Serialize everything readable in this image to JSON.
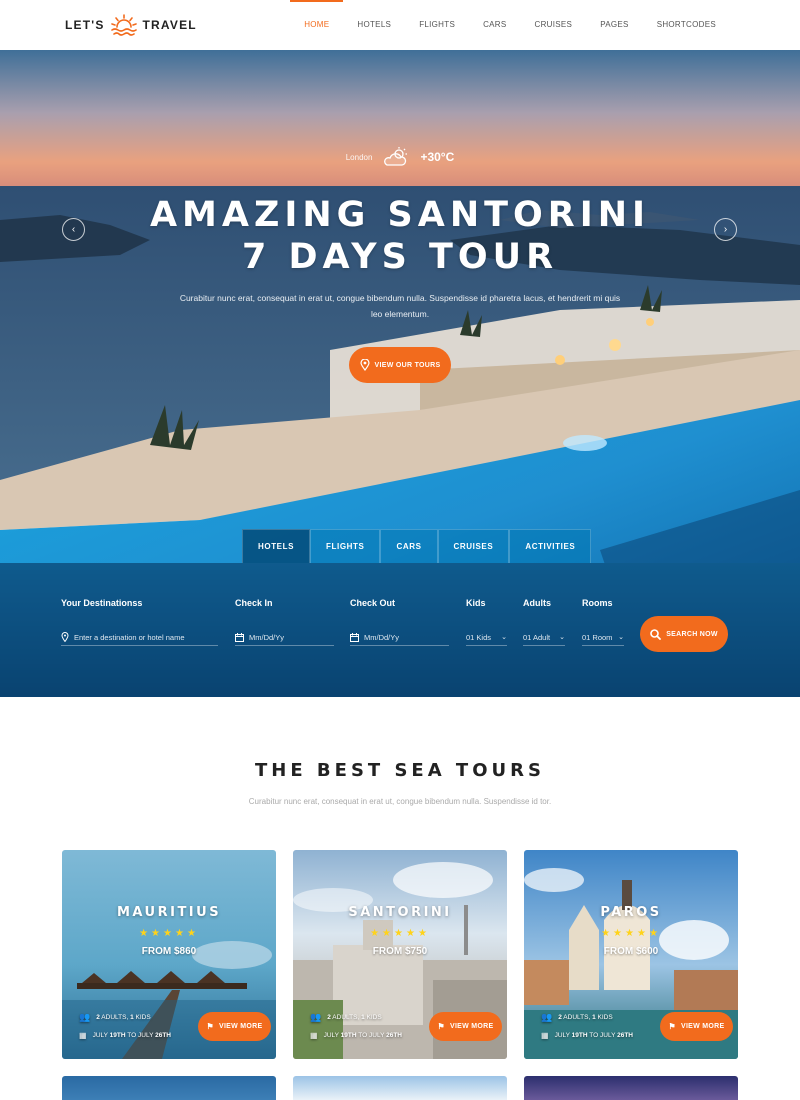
{
  "header": {
    "logo_left": "LET'S",
    "logo_right": "TRAVEL",
    "nav": [
      "HOME",
      "HOTELS",
      "FLIGHTS",
      "CARS",
      "CRUISES",
      "PAGES",
      "SHORTCODES"
    ],
    "active_nav": "HOME"
  },
  "hero": {
    "weather": {
      "city": "London",
      "temp": "+30°C",
      "icon": "partly-cloudy-icon"
    },
    "title_line1": "AMAZING SANTORINI",
    "title_line2": "7 DAYS TOUR",
    "description": "Curabitur nunc erat, consequat in erat ut, congue bibendum nulla. Suspendisse id pharetra lacus, et hendrerit mi quis leo elementum.",
    "cta_label": "VIEW OUR TOURS"
  },
  "search": {
    "tabs": [
      "HOTELS",
      "FLIGHTS",
      "CARS",
      "CRUISES",
      "ACTIVITIES"
    ],
    "active_tab": "HOTELS",
    "destination": {
      "label": "Your Destinationss",
      "placeholder": "Enter a destination or hotel name"
    },
    "check_in": {
      "label": "Check In",
      "placeholder": "Mm/Dd/Yy"
    },
    "check_out": {
      "label": "Check Out",
      "placeholder": "Mm/Dd/Yy"
    },
    "kids": {
      "label": "Kids",
      "value": "01 Kids"
    },
    "adults": {
      "label": "Adults",
      "value": "01 Adult"
    },
    "rooms": {
      "label": "Rooms",
      "value": "01 Room"
    },
    "button_label": "SEARCH NOW"
  },
  "section": {
    "title": "THE BEST SEA TOURS",
    "subtitle": "Curabitur nunc erat, consequat in erat ut, congue bibendum nulla. Suspendisse id tor."
  },
  "tours": [
    {
      "name": "MAURITIUS",
      "price": "FROM $860",
      "rating": 5,
      "stars": "★★★★★",
      "adults_num": "2",
      "adults_word": "ADULTS,",
      "kids_num": "1",
      "kids_word": "KIDS",
      "date_from": "JULY",
      "date_from_day": "19TH",
      "date_sep": "TO JULY",
      "date_to_day": "26TH",
      "button": "VIEW MORE"
    },
    {
      "name": "SANTORINI",
      "price": "FROM $750",
      "rating": 5,
      "stars": "★★★★★",
      "adults_num": "2",
      "adults_word": "ADULTS,",
      "kids_num": "1",
      "kids_word": "KIDS",
      "date_from": "JULY",
      "date_from_day": "19TH",
      "date_sep": "TO JULY",
      "date_to_day": "26TH",
      "button": "VIEW MORE"
    },
    {
      "name": "PAROS",
      "price": "FROM $600",
      "rating": 5,
      "stars": "★★★★★",
      "adults_num": "2",
      "adults_word": "ADULTS,",
      "kids_num": "1",
      "kids_word": "KIDS",
      "date_from": "JULY",
      "date_from_day": "19TH",
      "date_sep": "TO JULY",
      "date_to_day": "26TH",
      "button": "VIEW MORE"
    }
  ],
  "colors": {
    "accent": "#f26b1d",
    "star": "#ffd31a",
    "heading": "#222222"
  }
}
